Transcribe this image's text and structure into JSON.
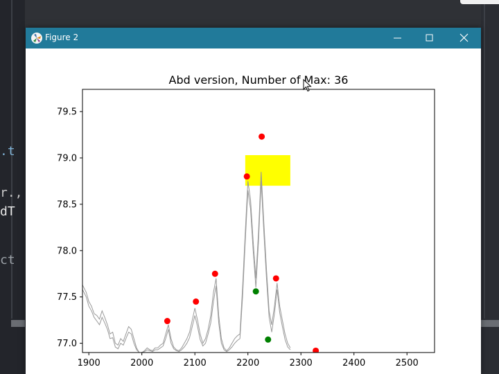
{
  "window": {
    "title": "Figure 2",
    "controls": [
      "minimize",
      "maximize",
      "close"
    ],
    "titlebar_color": "#217a9a"
  },
  "background_code": {
    "lines": [
      ".t",
      "r.,",
      "dT",
      "ct"
    ]
  },
  "chart_data": {
    "type": "line",
    "title": "Abd version, Number of Max: 36",
    "xlabel": "",
    "ylabel": "",
    "xlim": [
      1888,
      2552
    ],
    "ylim": [
      76.9,
      79.74
    ],
    "x_ticks": [
      1900,
      2000,
      2100,
      2200,
      2300,
      2400,
      2500
    ],
    "x_tick_labels": [
      "1900",
      "2000",
      "2100",
      "2200",
      "2300",
      "2400",
      "2500"
    ],
    "y_ticks": [
      77.0,
      77.5,
      78.0,
      78.5,
      79.0,
      79.5
    ],
    "y_tick_labels": [
      "77.0",
      "77.5",
      "78.0",
      "78.5",
      "79.0",
      "79.5"
    ],
    "grid": false,
    "line_color": "#999999",
    "series": [
      {
        "values_x": [
          1888,
          1895,
          1900,
          1905,
          1910,
          1915,
          1920,
          1925,
          1930,
          1935,
          1940,
          1945,
          1950,
          1955,
          1960,
          1965,
          1970,
          1975,
          1980,
          1985,
          1990,
          1995,
          2000,
          2005,
          2010,
          2015,
          2020,
          2025,
          2030,
          2035,
          2040,
          2045,
          2050,
          2055,
          2060,
          2065,
          2070,
          2075,
          2080,
          2085,
          2090,
          2095,
          2100,
          2105,
          2110,
          2115,
          2120,
          2125,
          2130,
          2135,
          2140,
          2145,
          2150,
          2155,
          2160,
          2165,
          2170,
          2175,
          2180,
          2185,
          2190,
          2195,
          2200,
          2205,
          2210,
          2215,
          2220,
          2225,
          2230,
          2235,
          2240,
          2245,
          2250,
          2255,
          2260,
          2265,
          2270,
          2275,
          2280
        ],
        "values_y": [
          77.63,
          77.55,
          77.45,
          77.4,
          77.32,
          77.3,
          77.26,
          77.35,
          77.28,
          77.2,
          77.1,
          77.12,
          77.0,
          76.98,
          77.05,
          77.02,
          77.1,
          77.18,
          77.15,
          77.05,
          76.95,
          76.9,
          76.9,
          76.92,
          76.95,
          76.93,
          76.92,
          76.95,
          76.95,
          76.98,
          77.0,
          77.1,
          77.2,
          77.05,
          76.96,
          76.93,
          76.92,
          76.95,
          77.0,
          77.05,
          77.12,
          77.25,
          77.38,
          77.25,
          77.1,
          77.0,
          77.05,
          77.15,
          77.3,
          77.55,
          77.7,
          77.3,
          77.05,
          76.95,
          76.92,
          76.95,
          77.0,
          77.05,
          77.08,
          77.1,
          77.6,
          78.2,
          78.75,
          78.55,
          78.1,
          77.7,
          78.2,
          78.85,
          78.3,
          77.8,
          77.35,
          77.2,
          77.4,
          77.65,
          77.4,
          77.25,
          77.1,
          77.0,
          76.95
        ]
      },
      {
        "values_x": [
          1888,
          1895,
          1900,
          1905,
          1910,
          1915,
          1920,
          1925,
          1930,
          1935,
          1940,
          1945,
          1950,
          1955,
          1960,
          1965,
          1970,
          1975,
          1980,
          1985,
          1990,
          1995,
          2000,
          2005,
          2010,
          2015,
          2020,
          2025,
          2030,
          2035,
          2040,
          2045,
          2050,
          2055,
          2060,
          2065,
          2070,
          2075,
          2080,
          2085,
          2090,
          2095,
          2100,
          2105,
          2110,
          2115,
          2120,
          2125,
          2130,
          2135,
          2140,
          2145,
          2150,
          2155,
          2160,
          2165,
          2170,
          2175,
          2180,
          2185,
          2190,
          2195,
          2200,
          2205,
          2210,
          2215,
          2220,
          2225,
          2230,
          2235,
          2240,
          2245,
          2250,
          2255,
          2260,
          2265,
          2270,
          2275,
          2280
        ],
        "values_y": [
          77.58,
          77.5,
          77.4,
          77.35,
          77.28,
          77.24,
          77.2,
          77.28,
          77.22,
          77.15,
          77.05,
          77.06,
          76.96,
          76.94,
          77.0,
          76.98,
          77.05,
          77.12,
          77.1,
          77.0,
          76.93,
          76.9,
          76.9,
          76.91,
          76.93,
          76.92,
          76.91,
          76.93,
          76.93,
          76.95,
          76.97,
          77.05,
          77.15,
          77.0,
          76.94,
          76.92,
          76.91,
          76.93,
          76.96,
          77.0,
          77.06,
          77.18,
          77.3,
          77.18,
          77.04,
          76.97,
          77.0,
          77.1,
          77.22,
          77.45,
          77.62,
          77.22,
          77.0,
          76.93,
          76.91,
          76.93,
          76.96,
          77.0,
          77.03,
          77.05,
          77.5,
          78.1,
          78.65,
          78.45,
          78.0,
          77.6,
          78.1,
          78.75,
          78.2,
          77.7,
          77.28,
          77.12,
          77.32,
          77.58,
          77.33,
          77.18,
          77.04,
          76.96,
          76.93
        ]
      }
    ],
    "maxima_points": {
      "color": "#ff0000",
      "x": [
        2048,
        2102,
        2138,
        2198,
        2226,
        2253,
        2328
      ],
      "y": [
        77.24,
        77.45,
        77.75,
        78.8,
        79.23,
        77.7,
        76.92
      ]
    },
    "minima_points": {
      "color": "#008000",
      "x": [
        2215,
        2238
      ],
      "y": [
        77.56,
        77.04
      ]
    },
    "highlight_rect": {
      "color": "#ffff00",
      "x_range": [
        2195,
        2280
      ],
      "y_range": [
        78.7,
        79.03
      ]
    }
  }
}
